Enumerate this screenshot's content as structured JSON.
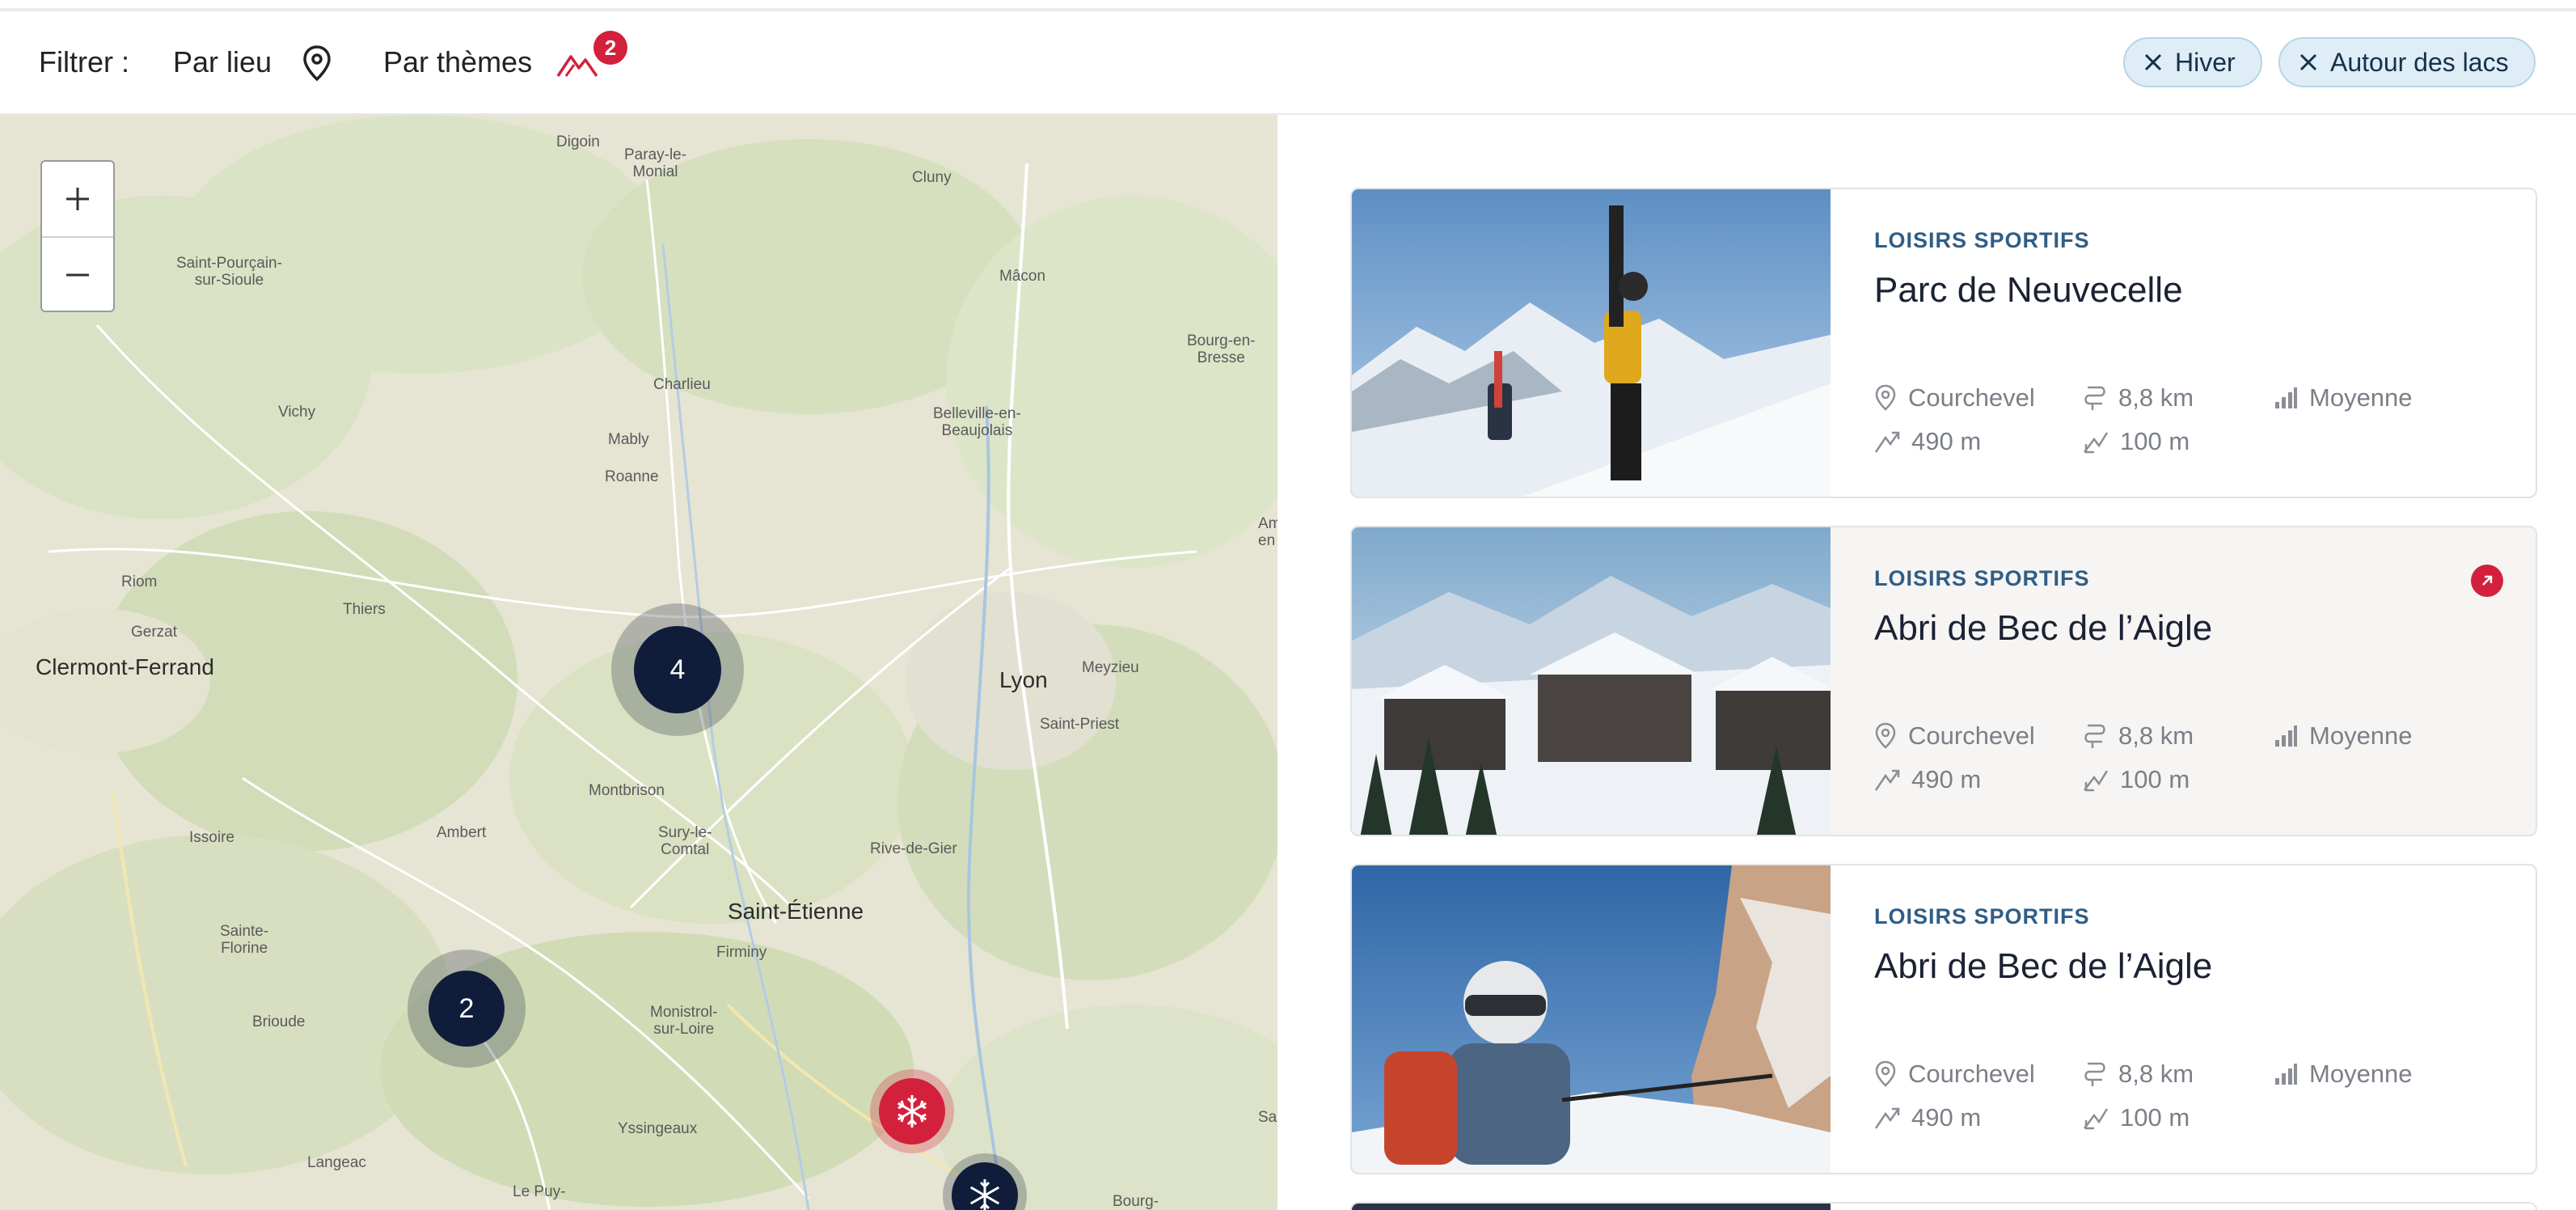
{
  "filters": {
    "label": "Filtrer :",
    "by_place": "Par lieu",
    "by_theme": "Par thèmes",
    "theme_count": "2",
    "active_chips": [
      "Hiver",
      "Autour des lacs"
    ]
  },
  "map": {
    "zoom_in": "+",
    "zoom_out": "−",
    "labels": {
      "digoin": "Digoin",
      "paray": "Paray-le-\nMonial",
      "cluny": "Cluny",
      "macon": "Mâcon",
      "bourg_bresse": "Bourg-en-\nBresse",
      "st_pourcain": "Saint-Pourçain-\nsur-Sioule",
      "vichy": "Vichy",
      "charlieu": "Charlieu",
      "belleville": "Belleville-en-\nBeaujolais",
      "mably": "Mably",
      "roanne": "Roanne",
      "am": "Am\nen",
      "riom": "Riom",
      "gerzat": "Gerzat",
      "thiers": "Thiers",
      "clermont": "Clermont-Ferrand",
      "lyon": "Lyon",
      "meyzieu": "Meyzieu",
      "saint_priest": "Saint-Priest",
      "montbrison": "Montbrison",
      "issoire": "Issoire",
      "ambert": "Ambert",
      "sury": "Sury-le-\nComtal",
      "rive_gier": "Rive-de-Gier",
      "saint_etienne": "Saint-Étienne",
      "firminy": "Firminy",
      "sainte_florine": "Sainte-\nFlorine",
      "brioude": "Brioude",
      "monistrol": "Monistrol-\nsur-Loire",
      "sa": "Sa",
      "yssingeaux": "Yssingeaux",
      "langeac": "Langeac",
      "le_puy": "Le Puy-",
      "bourg": "Bourg-"
    },
    "clusters": [
      {
        "count": "4"
      },
      {
        "count": "2"
      }
    ]
  },
  "cards": [
    {
      "category": "LOISIRS SPORTIFS",
      "title": "Parc de Neuvecelle",
      "location": "Courchevel",
      "distance": "8,8 km",
      "difficulty": "Moyenne",
      "ascent": "490 m",
      "descent": "100 m"
    },
    {
      "category": "LOISIRS SPORTIFS",
      "title": "Abri de Bec de l’Aigle",
      "location": "Courchevel",
      "distance": "8,8 km",
      "difficulty": "Moyenne",
      "ascent": "490 m",
      "descent": "100 m"
    },
    {
      "category": "LOISIRS SPORTIFS",
      "title": "Abri de Bec de l’Aigle",
      "location": "Courchevel",
      "distance": "8,8 km",
      "difficulty": "Moyenne",
      "ascent": "490 m",
      "descent": "100 m"
    }
  ],
  "colors": {
    "accent_red": "#d3203c",
    "navy": "#0f1d3a",
    "category_blue": "#2f5e86",
    "chip_bg": "#deedf6"
  }
}
